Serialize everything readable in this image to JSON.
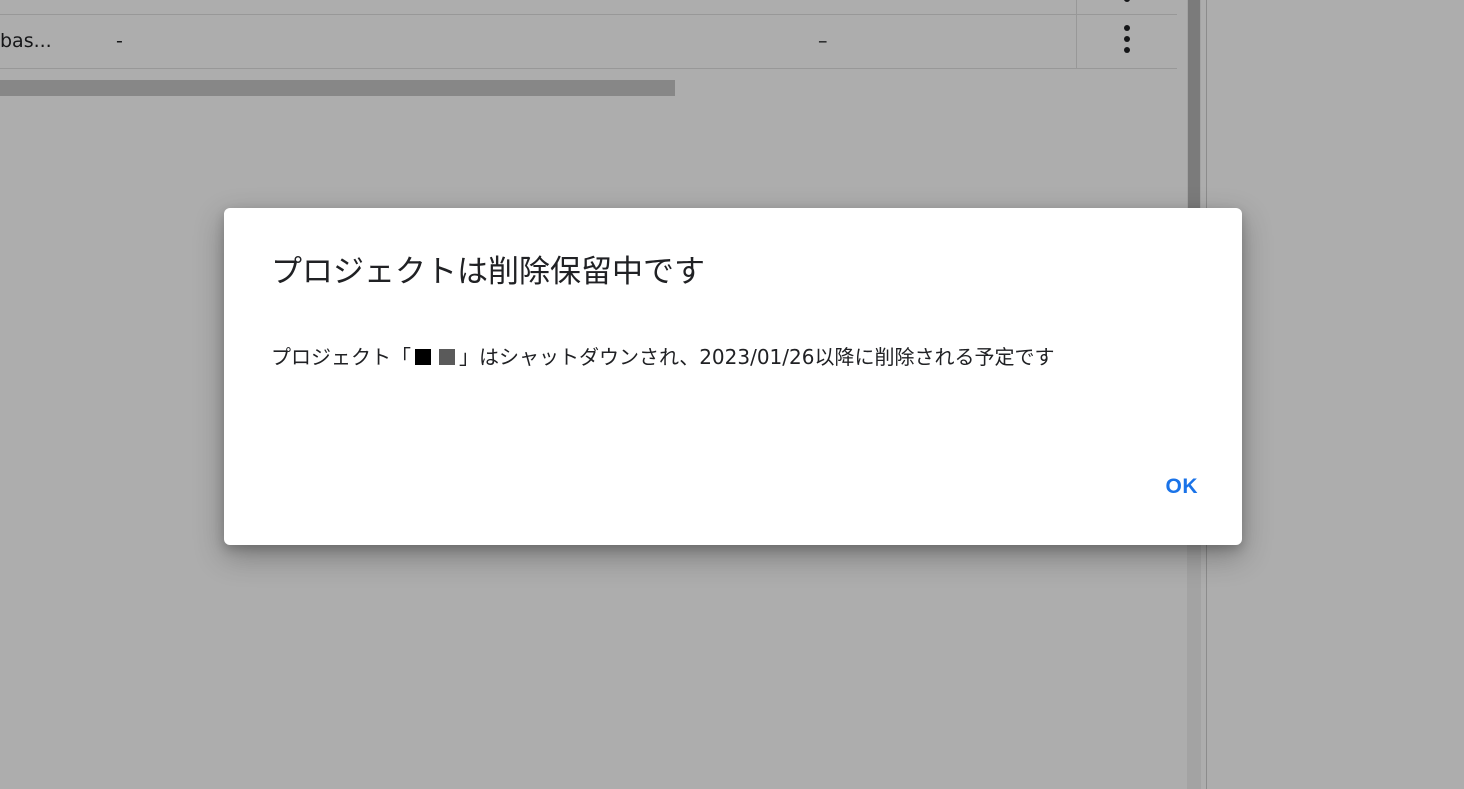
{
  "table": {
    "row": {
      "name": "bas...",
      "col2": "-",
      "col3": "–"
    }
  },
  "dialog": {
    "title": "プロジェクトは削除保留中です",
    "body_prefix": "プロジェクト「",
    "body_suffix": "」はシャットダウンされ、2023/01/26以降に削除される予定です",
    "ok_label": "OK"
  },
  "colors": {
    "accent": "#1a73e8",
    "scrim": "rgba(0,0,0,0.32)"
  },
  "icons": {
    "row_menu": "more-vert-icon"
  }
}
